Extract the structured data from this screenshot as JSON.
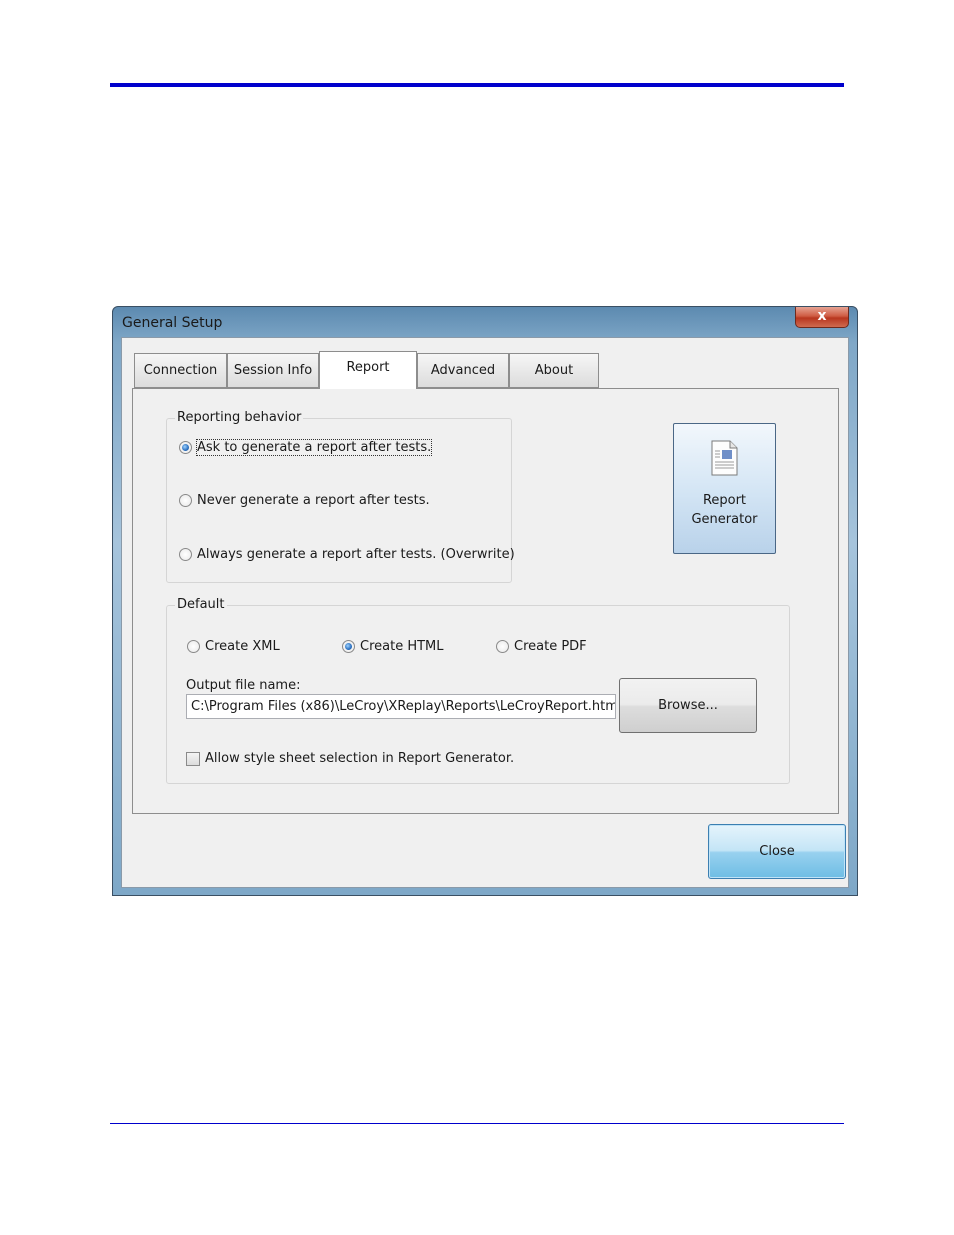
{
  "window": {
    "title": "General Setup",
    "close_glyph": "x"
  },
  "tabs": [
    {
      "label": "Connection"
    },
    {
      "label": "Session Info"
    },
    {
      "label": "Report"
    },
    {
      "label": "Advanced"
    },
    {
      "label": "About"
    }
  ],
  "active_tab": "Report",
  "reporting_behavior": {
    "label": "Reporting behavior",
    "options": [
      {
        "label": "Ask to generate a report after tests.",
        "checked": true
      },
      {
        "label": "Never generate a report after tests.",
        "checked": false
      },
      {
        "label": "Always generate a report after tests. (Overwrite)",
        "checked": false
      }
    ]
  },
  "report_generator_button": {
    "label": "Report\nGenerator",
    "icon": "document-icon"
  },
  "default": {
    "label": "Default",
    "formats": [
      {
        "label": "Create XML",
        "checked": false
      },
      {
        "label": "Create HTML",
        "checked": true
      },
      {
        "label": "Create PDF",
        "checked": false
      }
    ],
    "output_label": "Output file name:",
    "output_value": "C:\\Program Files (x86)\\LeCroy\\XReplay\\Reports\\LeCroyReport.htm",
    "browse_label": "Browse...",
    "stylesheet_label": "Allow style sheet selection in Report Generator.",
    "stylesheet_checked": false
  },
  "close_button": {
    "label": "Close"
  },
  "colors": {
    "rule": "#0000cc",
    "accent": "#3c7fb1"
  }
}
